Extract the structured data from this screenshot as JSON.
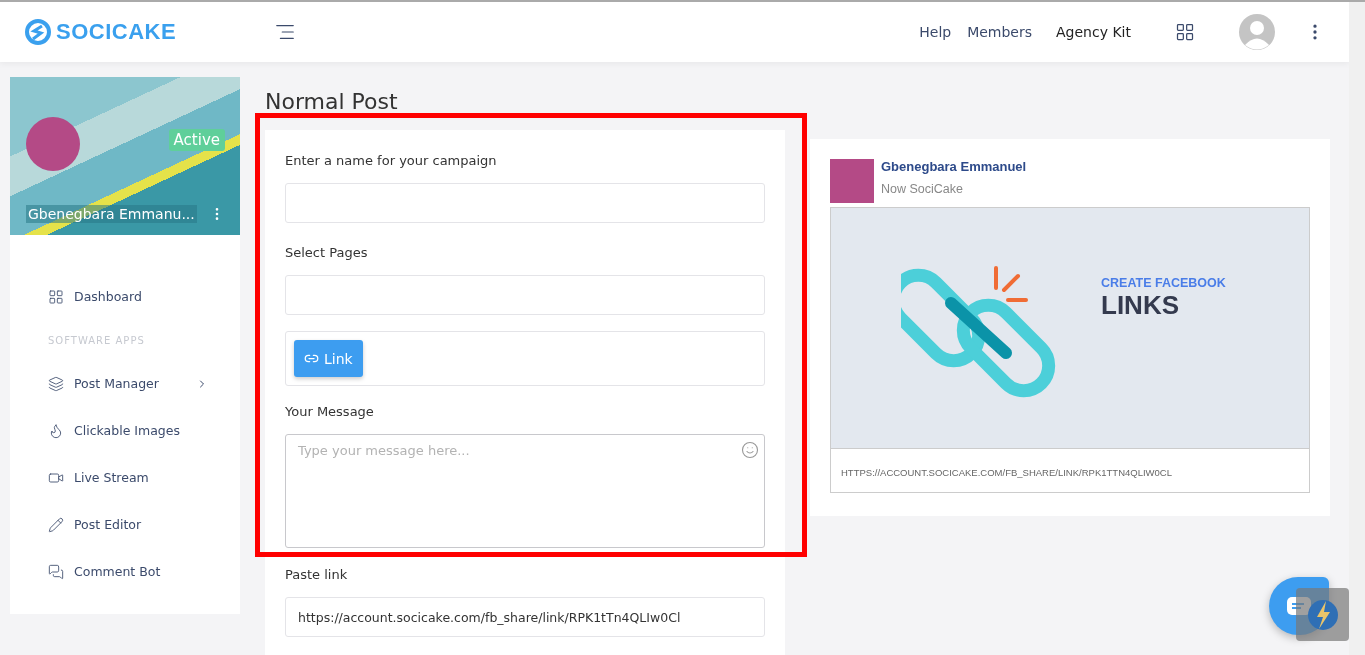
{
  "header": {
    "logo": "SOCICAKE",
    "nav": [
      "Help",
      "Members",
      "Agency Kit"
    ]
  },
  "profile": {
    "name": "Gbenegbara Emmanu...",
    "status": "Active"
  },
  "sidebar": {
    "items": [
      {
        "kind": "link",
        "label": "Dashboard",
        "submenu": false
      },
      {
        "kind": "section",
        "label": "SOFTWARE APPS"
      },
      {
        "kind": "link",
        "label": "Post Manager",
        "submenu": true
      },
      {
        "kind": "link",
        "label": "Clickable Images",
        "submenu": false
      },
      {
        "kind": "link",
        "label": "Live Stream",
        "submenu": false
      },
      {
        "kind": "link",
        "label": "Post Editor",
        "submenu": false
      },
      {
        "kind": "link",
        "label": "Comment Bot",
        "submenu": false
      }
    ]
  },
  "page_title": "Normal Post",
  "form": {
    "campaign_label": "Enter a name for your campaign",
    "pages_label": "Select Pages",
    "link_button": "Link",
    "message_label": "Your Message",
    "message_placeholder": "Type your message here...",
    "paste_label": "Paste link",
    "paste_value": "https://account.socicake.com/fb_share/link/RPK1tTn4QLIw0Cl"
  },
  "preview": {
    "name": "Gbenegbara Emmanuel",
    "subtitle": "Now SociCake",
    "image_kicker": "CREATE FACEBOOK",
    "image_title": "LINKS",
    "url": "HTTPS://ACCOUNT.SOCICAKE.COM/FB_SHARE/LINK/RPK1TTN4QLIW0CL"
  }
}
